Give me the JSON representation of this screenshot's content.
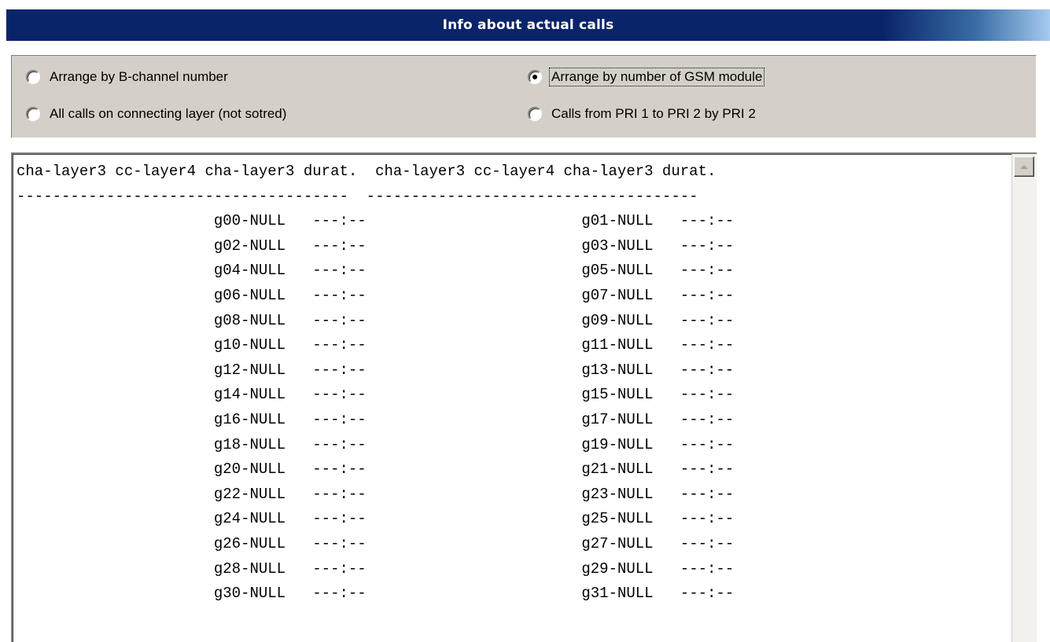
{
  "window": {
    "title": "Info about actual calls"
  },
  "options": [
    {
      "label": "Arrange by B-channel number",
      "checked": false,
      "focused": false
    },
    {
      "label": "Arrange by number of GSM module",
      "checked": true,
      "focused": true
    },
    {
      "label": "All calls on connecting layer (not sotred)",
      "checked": false,
      "focused": false
    },
    {
      "label": "Calls from PRI 1 to PRI 2 by PRI 2",
      "checked": false,
      "focused": false
    }
  ],
  "calls_list": {
    "header": "cha-layer3 cc-layer4 cha-layer3 durat.  cha-layer3 cc-layer4 cha-layer3 durat.",
    "separator": "-------------------------------------  -------------------------------------",
    "rows": [
      {
        "left_module": "g00-NULL",
        "left_duration": "---:--",
        "right_module": "g01-NULL",
        "right_duration": "---:--"
      },
      {
        "left_module": "g02-NULL",
        "left_duration": "---:--",
        "right_module": "g03-NULL",
        "right_duration": "---:--"
      },
      {
        "left_module": "g04-NULL",
        "left_duration": "---:--",
        "right_module": "g05-NULL",
        "right_duration": "---:--"
      },
      {
        "left_module": "g06-NULL",
        "left_duration": "---:--",
        "right_module": "g07-NULL",
        "right_duration": "---:--"
      },
      {
        "left_module": "g08-NULL",
        "left_duration": "---:--",
        "right_module": "g09-NULL",
        "right_duration": "---:--"
      },
      {
        "left_module": "g10-NULL",
        "left_duration": "---:--",
        "right_module": "g11-NULL",
        "right_duration": "---:--"
      },
      {
        "left_module": "g12-NULL",
        "left_duration": "---:--",
        "right_module": "g13-NULL",
        "right_duration": "---:--"
      },
      {
        "left_module": "g14-NULL",
        "left_duration": "---:--",
        "right_module": "g15-NULL",
        "right_duration": "---:--"
      },
      {
        "left_module": "g16-NULL",
        "left_duration": "---:--",
        "right_module": "g17-NULL",
        "right_duration": "---:--"
      },
      {
        "left_module": "g18-NULL",
        "left_duration": "---:--",
        "right_module": "g19-NULL",
        "right_duration": "---:--"
      },
      {
        "left_module": "g20-NULL",
        "left_duration": "---:--",
        "right_module": "g21-NULL",
        "right_duration": "---:--"
      },
      {
        "left_module": "g22-NULL",
        "left_duration": "---:--",
        "right_module": "g23-NULL",
        "right_duration": "---:--"
      },
      {
        "left_module": "g24-NULL",
        "left_duration": "---:--",
        "right_module": "g25-NULL",
        "right_duration": "---:--"
      },
      {
        "left_module": "g26-NULL",
        "left_duration": "---:--",
        "right_module": "g27-NULL",
        "right_duration": "---:--"
      },
      {
        "left_module": "g28-NULL",
        "left_duration": "---:--",
        "right_module": "g29-NULL",
        "right_duration": "---:--"
      },
      {
        "left_module": "g30-NULL",
        "left_duration": "---:--",
        "right_module": "g31-NULL",
        "right_duration": "---:--"
      }
    ]
  },
  "scrollbar": {
    "icon": "arrow-up-icon"
  },
  "colors": {
    "title_bar": "#0a246a",
    "panel_bg": "#d4d0c8"
  }
}
